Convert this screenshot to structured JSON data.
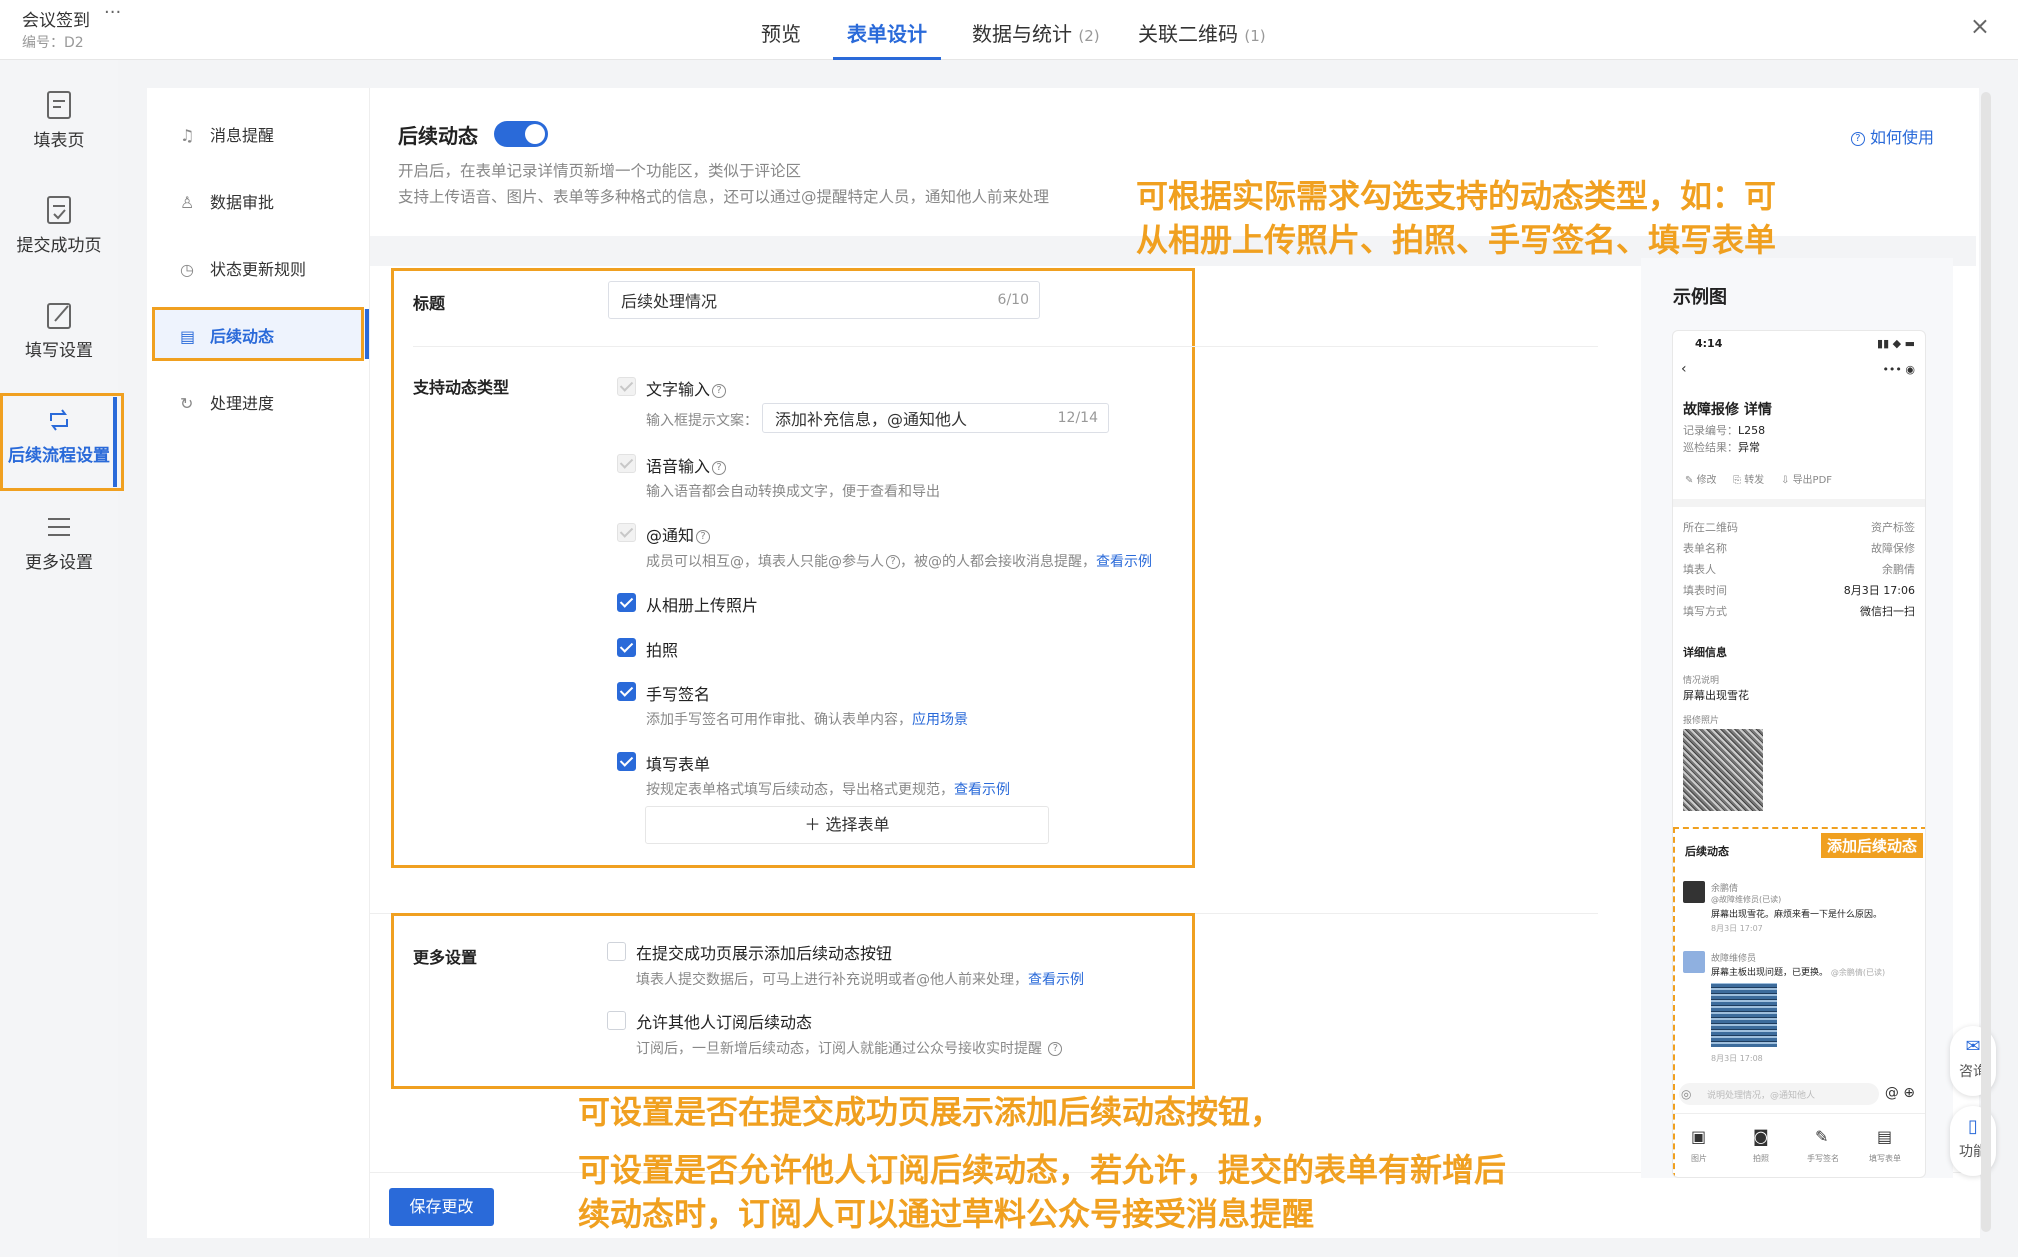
{
  "app": {
    "title": "会议签到",
    "more": "···",
    "code": "编号：D2",
    "close": "×"
  },
  "tabs": [
    {
      "label": "预览",
      "count": ""
    },
    {
      "label": "表单设计",
      "count": ""
    },
    {
      "label": "数据与统计",
      "count": "(2)"
    },
    {
      "label": "关联二维码",
      "count": "(1)"
    }
  ],
  "rail": [
    {
      "label": "填表页",
      "icon": "form-icon"
    },
    {
      "label": "提交成功页",
      "icon": "check-form-icon"
    },
    {
      "label": "填写设置",
      "icon": "edit-icon"
    },
    {
      "label": "后续流程设置",
      "icon": "refresh-icon"
    },
    {
      "label": "更多设置",
      "icon": "menu-icon"
    }
  ],
  "subnav": [
    {
      "label": "消息提醒",
      "icon": "bell-icon"
    },
    {
      "label": "数据审批",
      "icon": "user-approve-icon"
    },
    {
      "label": "状态更新规则",
      "icon": "clock-icon"
    },
    {
      "label": "后续动态",
      "icon": "doc-icon"
    },
    {
      "label": "处理进度",
      "icon": "progress-icon"
    }
  ],
  "section": {
    "title": "后续动态",
    "enabled": true,
    "desc1": "开启后，在表单记录详情页新增一个功能区，类似于评论区",
    "desc2": "支持上传语音、图片、表单等多种格式的信息，还可以通过@提醒特定人员，通知他人前来处理",
    "help": "如何使用"
  },
  "form": {
    "title_label": "标题",
    "title_value": "后续处理情况",
    "title_count": "6/10",
    "types_label": "支持动态类型",
    "text_input": "文字输入",
    "prompt_label": "输入框提示文案：",
    "prompt_value": "添加补充信息，@通知他人",
    "prompt_count": "12/14",
    "voice_input": "语音输入",
    "voice_hint": "输入语音都会自动转换成文字，便于查看和导出",
    "notify": "@通知",
    "notify_hint": "成员可以相互@，填表人只能@参与人",
    "notify_hint2": "，被@的人都会接收消息提醒，",
    "notify_link": "查看示例",
    "album": "从相册上传照片",
    "photo": "拍照",
    "sign": "手写签名",
    "sign_hint": "添加手写签名可用作审批、确认表单内容，",
    "sign_link": "应用场景",
    "fillform": "填写表单",
    "fillform_hint": "按规定表单格式填写后续动态，导出格式更规范，",
    "fillform_link": "查看示例",
    "select_form": "选择表单"
  },
  "more": {
    "label": "更多设置",
    "opt1": "在提交成功页展示添加后续动态按钮",
    "opt1_hint": "填表人提交数据后，可马上进行补充说明或者@他人前来处理，",
    "opt1_link": "查看示例",
    "opt2": "允许其他人订阅后续动态",
    "opt2_hint": "订阅后，一旦新增后续动态，订阅人就能通过公众号接收实时提醒"
  },
  "save": "保存更改",
  "notes": {
    "n1a": "可根据实际需求勾选支持的动态类型，如：可",
    "n1b": "从相册上传照片、拍照、手写签名、填写表单",
    "n2": "可设置是否在提交成功页展示添加后续动态按钮，",
    "n3a": "可设置是否允许他人订阅后续动态，若允许，提交的表单有新增后",
    "n3b": "续动态时，订阅人可以通过草料公众号接受消息提醒"
  },
  "example": {
    "title": "示例图",
    "time": "4:14",
    "heading": "故障报修 详情",
    "rec_no": "记录编号：",
    "rec_no_v": "L258",
    "result": "巡检结果：",
    "result_v": "异常",
    "actions": [
      "修改",
      "转发",
      "导出PDF"
    ],
    "fields": [
      {
        "k": "所在二维码",
        "v": "资产标签"
      },
      {
        "k": "表单名称",
        "v": "故障保修"
      },
      {
        "k": "填表人",
        "v": "余鹏倩"
      },
      {
        "k": "填表时间",
        "v": "8月3日 17:06"
      },
      {
        "k": "填写方式",
        "v": "微信扫一扫"
      }
    ],
    "detail": "详细信息",
    "situation": "情况说明",
    "situation_v": "屏幕出现雪花",
    "photo_label": "报修照片",
    "followup": "后续动态",
    "add_tag": "添加后续动态",
    "c1_name": "余鹏倩",
    "c1_sub": "@故障维修员(已读)",
    "c1_text": "屏幕出现雪花。麻烦来看一下是什么原因。",
    "c1_time": "8月3日 17:07",
    "c2_name": "故障维修员",
    "c2_text": "屏幕主板出现问题，已更换。",
    "c2_at": "@余鹏倩(已读)",
    "c2_time": "8月3日 17:08",
    "input_ph": "说明处理情况，@通知他人",
    "tools": [
      "图片",
      "拍照",
      "手写签名",
      "填写表单"
    ]
  },
  "float": {
    "consult": "咨询",
    "func": "功能"
  }
}
